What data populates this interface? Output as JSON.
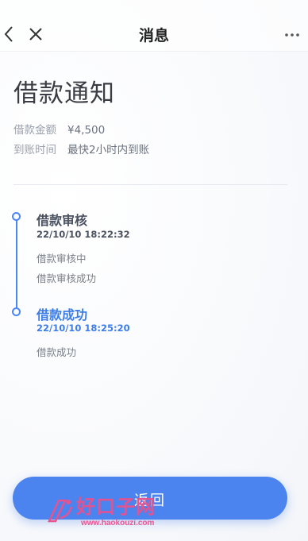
{
  "nav": {
    "title": "消息",
    "back_icon": "chevron-left-icon",
    "close_icon": "close-icon",
    "more_icon": "more-horizontal-icon"
  },
  "notice": {
    "title": "借款通知",
    "amount_label": "借款金额",
    "amount_value": "¥4,500",
    "arrival_label": "到账时间",
    "arrival_value": "最快2小时内到账"
  },
  "timeline": [
    {
      "title": "借款审核",
      "time": "22/10/10 18:22:32",
      "details": [
        "借款审核中",
        "借款审核成功"
      ],
      "color": "#4a5160"
    },
    {
      "title": "借款成功",
      "time": "22/10/10 18:25:20",
      "details": [
        "借款成功"
      ],
      "color": "#3d7de8"
    }
  ],
  "footer": {
    "return_label": "返回"
  },
  "watermark": {
    "text": "好口子网",
    "url": "www.haokouzi.com"
  },
  "colors": {
    "accent": "#4a86f7",
    "button": "#4b83ef",
    "watermark": "#e8528e"
  }
}
